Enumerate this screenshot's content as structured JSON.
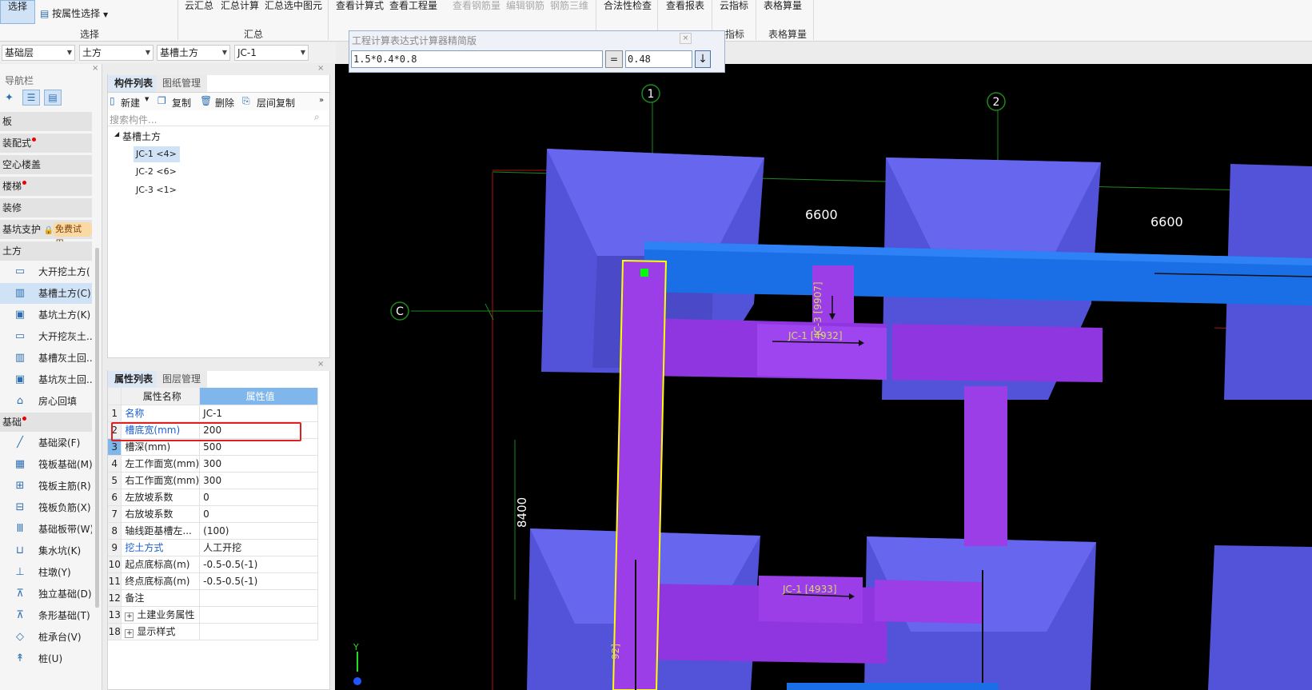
{
  "ribbon": {
    "select_btn": "选择",
    "select_by_attr": "按属性选择",
    "group_select": "选择",
    "cloud_summary": "云汇总",
    "summary_calc": "汇总计算",
    "summary_selected": "汇总选中图元",
    "group_summary": "汇总",
    "view_formula": "查看计算式",
    "view_quantity": "查看工程量",
    "view_rebar": "查看钢筋量",
    "edit_rebar": "编辑钢筋",
    "rebar_3d": "钢筋三维",
    "legality_check": "合法性检查",
    "view_report": "查看报表",
    "cloud_index": "云指标",
    "table_calc": "表格算量",
    "group_index": "指标",
    "group_table": "表格算量"
  },
  "selectors": [
    "基础层",
    "土方",
    "基槽土方",
    "JC-1"
  ],
  "calculator": {
    "title": "工程计算表达式计算器精简版",
    "expression": "1.5*0.4*0.8",
    "equals": "=",
    "result": "0.48",
    "down_arrow": "↓",
    "close": "×"
  },
  "nav": {
    "title": "导航栏",
    "categories": [
      {
        "label": "板",
        "dot": false
      },
      {
        "label": "装配式",
        "dot": true
      },
      {
        "label": "空心楼盖",
        "dot": false
      },
      {
        "label": "楼梯",
        "dot": true
      },
      {
        "label": "装修",
        "dot": false
      },
      {
        "label": "基坑支护",
        "dot": false
      }
    ],
    "free_trial": "免费试用",
    "earth_category": "土方",
    "earth_items": [
      {
        "icon": "▭",
        "label": "大开挖土方("
      },
      {
        "icon": "▥",
        "label": "基槽土方(C)"
      },
      {
        "icon": "▣",
        "label": "基坑土方(K)"
      },
      {
        "icon": "▭",
        "label": "大开挖灰土..."
      },
      {
        "icon": "▥",
        "label": "基槽灰土回..."
      },
      {
        "icon": "▣",
        "label": "基坑灰土回..."
      },
      {
        "icon": "⌂",
        "label": "房心回填"
      }
    ],
    "foundation_category": "基础",
    "foundation_items": [
      {
        "icon": "╱",
        "label": "基础梁(F)"
      },
      {
        "icon": "▦",
        "label": "筏板基础(M)"
      },
      {
        "icon": "⊞",
        "label": "筏板主筋(R)"
      },
      {
        "icon": "⊟",
        "label": "筏板负筋(X)"
      },
      {
        "icon": "Ⅲ",
        "label": "基础板带(W)"
      },
      {
        "icon": "⊔",
        "label": "集水坑(K)"
      },
      {
        "icon": "⊥",
        "label": "柱墩(Y)"
      },
      {
        "icon": "⊼",
        "label": "独立基础(D)"
      },
      {
        "icon": "⊼",
        "label": "条形基础(T)"
      },
      {
        "icon": "◇",
        "label": "桩承台(V)"
      },
      {
        "icon": "↟",
        "label": "桩(U)"
      }
    ]
  },
  "component_list": {
    "tab_active": "构件列表",
    "tab_other": "图纸管理",
    "new": "新建",
    "copy": "复制",
    "delete": "删除",
    "floor_copy": "层间复制",
    "more": "»",
    "search_placeholder": "搜索构件...",
    "tree_root": "基槽土方",
    "items": [
      "JC-1 <4>",
      "JC-2 <6>",
      "JC-3 <1>"
    ]
  },
  "properties": {
    "tab_active": "属性列表",
    "tab_other": "图层管理",
    "col_name": "属性名称",
    "col_value": "属性值",
    "rows": [
      {
        "num": "1",
        "name": "名称",
        "value": "JC-1",
        "link": true
      },
      {
        "num": "2",
        "name": "槽底宽(mm)",
        "value": "200",
        "link": true
      },
      {
        "num": "3",
        "name": "槽深(mm)",
        "value": "500",
        "link": false
      },
      {
        "num": "4",
        "name": "左工作面宽(mm)",
        "value": "300",
        "link": false
      },
      {
        "num": "5",
        "name": "右工作面宽(mm)",
        "value": "300",
        "link": false
      },
      {
        "num": "6",
        "name": "左放坡系数",
        "value": "0",
        "link": false
      },
      {
        "num": "7",
        "name": "右放坡系数",
        "value": "0",
        "link": false
      },
      {
        "num": "8",
        "name": "轴线距基槽左...",
        "value": "(100)",
        "link": false
      },
      {
        "num": "9",
        "name": "挖土方式",
        "value": "人工开挖",
        "link": true
      },
      {
        "num": "10",
        "name": "起点底标高(m)",
        "value": "-0.5-0.5(-1)",
        "link": false
      },
      {
        "num": "11",
        "name": "终点底标高(m)",
        "value": "-0.5-0.5(-1)",
        "link": false
      },
      {
        "num": "12",
        "name": "备注",
        "value": "",
        "link": false
      },
      {
        "num": "13",
        "name": "土建业务属性",
        "value": "",
        "link": false,
        "expand": true
      },
      {
        "num": "18",
        "name": "显示样式",
        "value": "",
        "link": false,
        "expand": true
      }
    ]
  },
  "canvas": {
    "axis_1": "1",
    "axis_2": "2",
    "axis_c": "C",
    "dim_1": "6600",
    "dim_2": "6600",
    "dim_v": "8400",
    "label_jc1_a": "JC-1 [4932]",
    "label_jc3": "JC-3 [9907]",
    "label_jc1_b": "JC-1 [4933]",
    "label_bottom": "92]",
    "axis_y": "Y"
  },
  "colors": {
    "trapezoid": "#5b5be0",
    "beam_blue": "#1a6fe6",
    "trench_purple": "#9b3ee8",
    "highlight_yellow": "#ffff00",
    "active_tab": "#dce8f5"
  }
}
